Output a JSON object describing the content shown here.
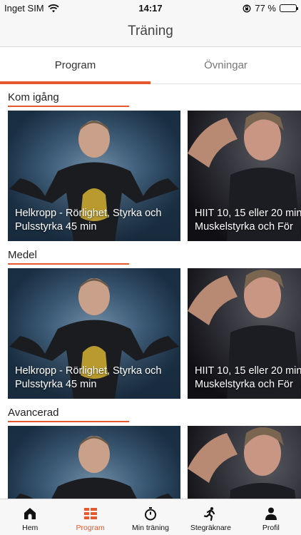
{
  "status_bar": {
    "carrier": "Inget SIM",
    "time": "14:17",
    "battery_text": "77 %",
    "battery_level": 0.77
  },
  "nav": {
    "title": "Träning"
  },
  "tabs": [
    {
      "label": "Program",
      "active": true
    },
    {
      "label": "Övningar",
      "active": false
    }
  ],
  "sections": [
    {
      "title": "Kom igång",
      "cards": [
        {
          "label": "Helkropp - Rörlighet, Styrka och\nPulsstyrka 45 min"
        },
        {
          "label": "HIIT 10, 15 eller 20 min\nMuskelstyrka och För"
        }
      ]
    },
    {
      "title": "Medel",
      "cards": [
        {
          "label": "Helkropp - Rörlighet, Styrka och\nPulsstyrka 45 min"
        },
        {
          "label": "HIIT 10, 15 eller 20 min\nMuskelstyrka och För"
        }
      ]
    },
    {
      "title": "Avancerad",
      "cards": [
        {
          "label": ""
        },
        {
          "label": ""
        }
      ]
    }
  ],
  "bottom_nav": [
    {
      "label": "Hem",
      "icon": "home-icon",
      "active": false
    },
    {
      "label": "Program",
      "icon": "grid-icon",
      "active": true
    },
    {
      "label": "Min träning",
      "icon": "stopwatch-icon",
      "active": false
    },
    {
      "label": "Stegräknare",
      "icon": "runner-icon",
      "active": false
    },
    {
      "label": "Profil",
      "icon": "person-icon",
      "active": false
    }
  ],
  "colors": {
    "accent": "#e8582e",
    "bar_bg": "#f7f7f7"
  }
}
